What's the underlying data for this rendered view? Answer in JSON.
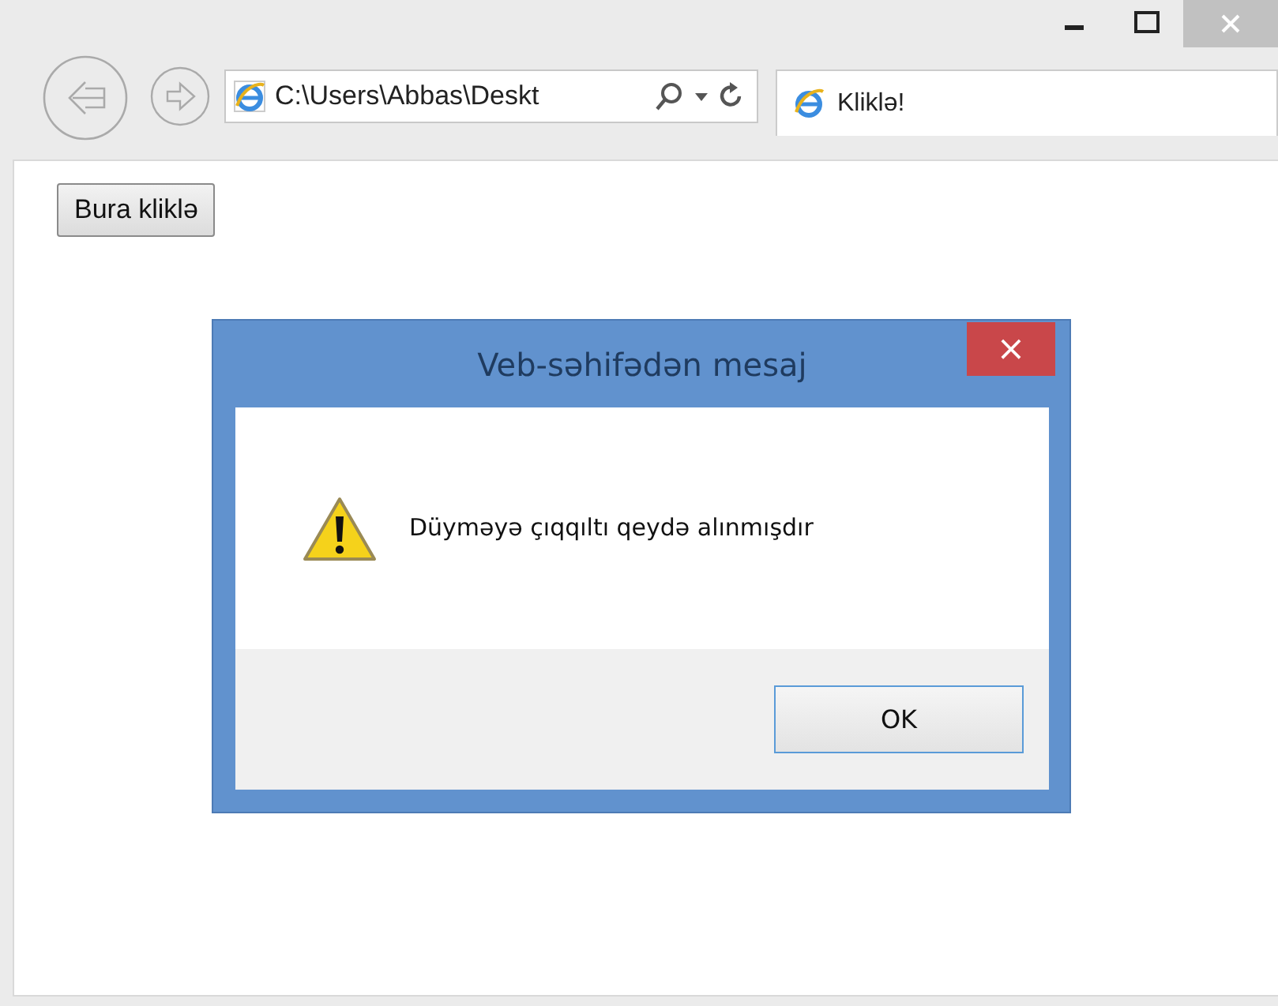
{
  "browser": {
    "address": "C:\\Users\\Abbas\\Deskt",
    "tab": {
      "title": "Kliklə!",
      "selected": true
    }
  },
  "page": {
    "button": "Bura kliklə"
  },
  "dialog": {
    "title": "Veb-səhifədən mesaj",
    "close": "×",
    "message": "Düyməyə çıqqıltı qeydə alınmışdır",
    "buttons": [
      "OK"
    ]
  }
}
